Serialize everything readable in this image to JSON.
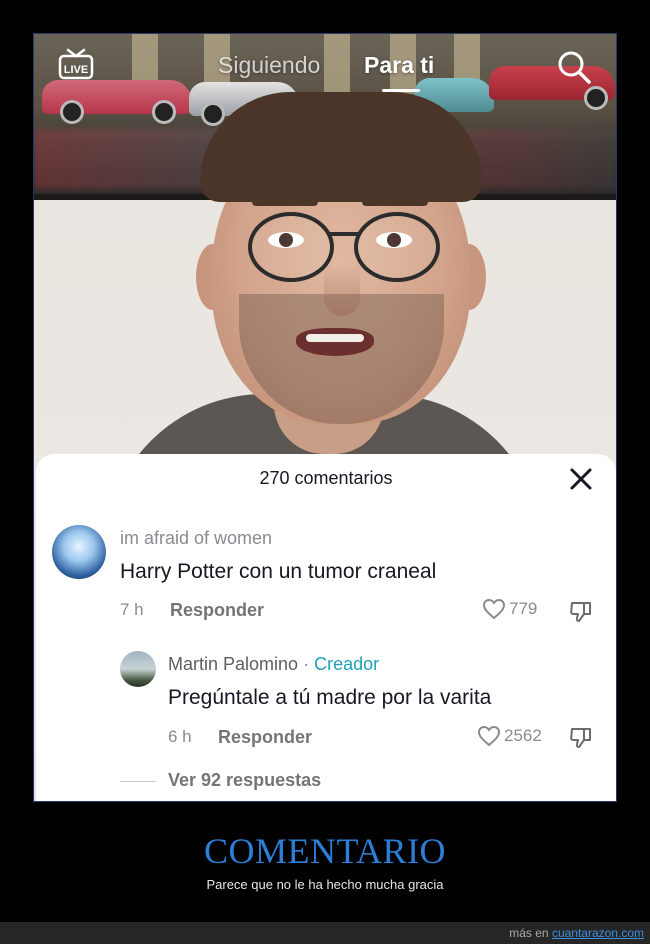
{
  "nav": {
    "live_label": "LIVE",
    "tab_following": "Siguiendo",
    "tab_for_you": "Para ti",
    "active_tab": "Para ti"
  },
  "comments_sheet": {
    "title": "270 comentarios",
    "comments": [
      {
        "username": "im afraid of women",
        "text": "Harry Potter con un tumor craneal",
        "time": "7 h",
        "reply_label": "Responder",
        "likes": "779"
      }
    ],
    "replies": [
      {
        "username": "Martin Palomino",
        "separator": "·",
        "badge": "Creador",
        "text": "Pregúntale a tú madre por la varita",
        "time": "6 h",
        "reply_label": "Responder",
        "likes": "2562"
      }
    ],
    "view_replies": "Ver 92 respuestas"
  },
  "caption": {
    "title": "COMENTARIO",
    "subtitle": "Parece que no le ha hecho mucha gracia"
  },
  "footer": {
    "prefix": "más en",
    "site": "cuantarazon.com"
  },
  "colors": {
    "caption_title": "#2b7fd6",
    "creator_badge": "#20a0b8",
    "background": "#000000",
    "sheet": "#ffffff"
  }
}
